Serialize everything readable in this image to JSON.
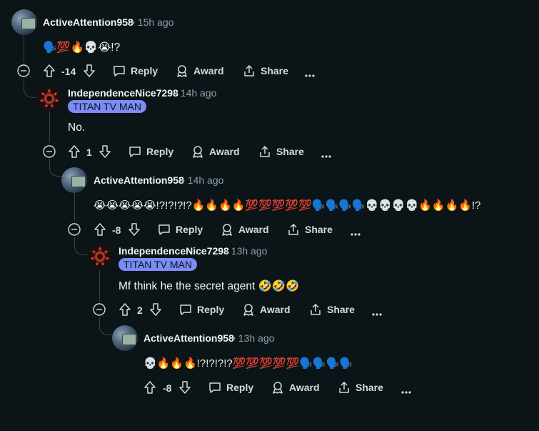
{
  "actions": {
    "reply": "Reply",
    "award": "Award",
    "share": "Share"
  },
  "comments": [
    {
      "author": "ActiveAttention958",
      "time": "15h ago",
      "body": "🗣️💯🔥💀😭!?",
      "votes": "-14"
    },
    {
      "author": "IndependenceNice7298",
      "time": "14h ago",
      "flair": "TITAN TV MAN",
      "body": "No.",
      "votes": "1"
    },
    {
      "author": "ActiveAttention958",
      "time": "14h ago",
      "body": "😭😭😭😭😭!?!?!?!?🔥🔥🔥🔥💯💯💯💯💯🗣️🗣️🗣️🗣️💀💀💀💀🔥🔥🔥🔥!?",
      "votes": "-8"
    },
    {
      "author": "IndependenceNice7298",
      "time": "13h ago",
      "flair": "TITAN TV MAN",
      "body": "Mf think he the secret agent 🤣🤣🤣",
      "votes": "2"
    },
    {
      "author": "ActiveAttention958",
      "time": "13h ago",
      "body": "💀🔥🔥🔥!?!?!?!?💯💯💯💯💯🗣️🗣️🗣️🗣️",
      "votes": "-8"
    }
  ]
}
